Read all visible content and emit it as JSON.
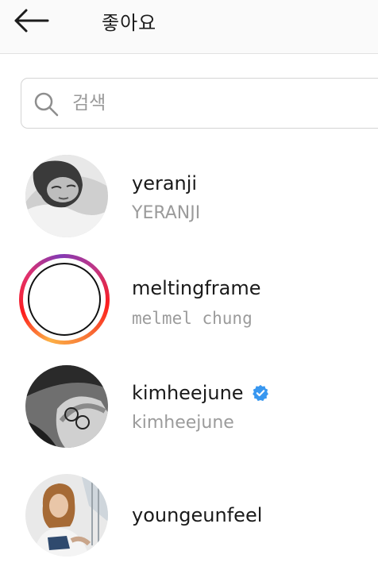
{
  "header": {
    "title": "좋아요"
  },
  "search": {
    "placeholder": "검색"
  },
  "users": [
    {
      "username": "yeranji",
      "full_name": "YERANJI",
      "has_story_ring": false,
      "verified": false
    },
    {
      "username": "meltingframe",
      "full_name": "melmel chung",
      "has_story_ring": true,
      "verified": false
    },
    {
      "username": "kimheejune",
      "full_name": "kimheejune",
      "has_story_ring": false,
      "verified": true
    },
    {
      "username": "youngeunfeel",
      "full_name": "",
      "has_story_ring": false,
      "verified": false
    }
  ],
  "colors": {
    "verified_badge": "#3897f0",
    "secondary_text": "#9b9b9b",
    "story_ring": [
      "#fcb045",
      "#fd1d1d",
      "#833ab4"
    ]
  }
}
